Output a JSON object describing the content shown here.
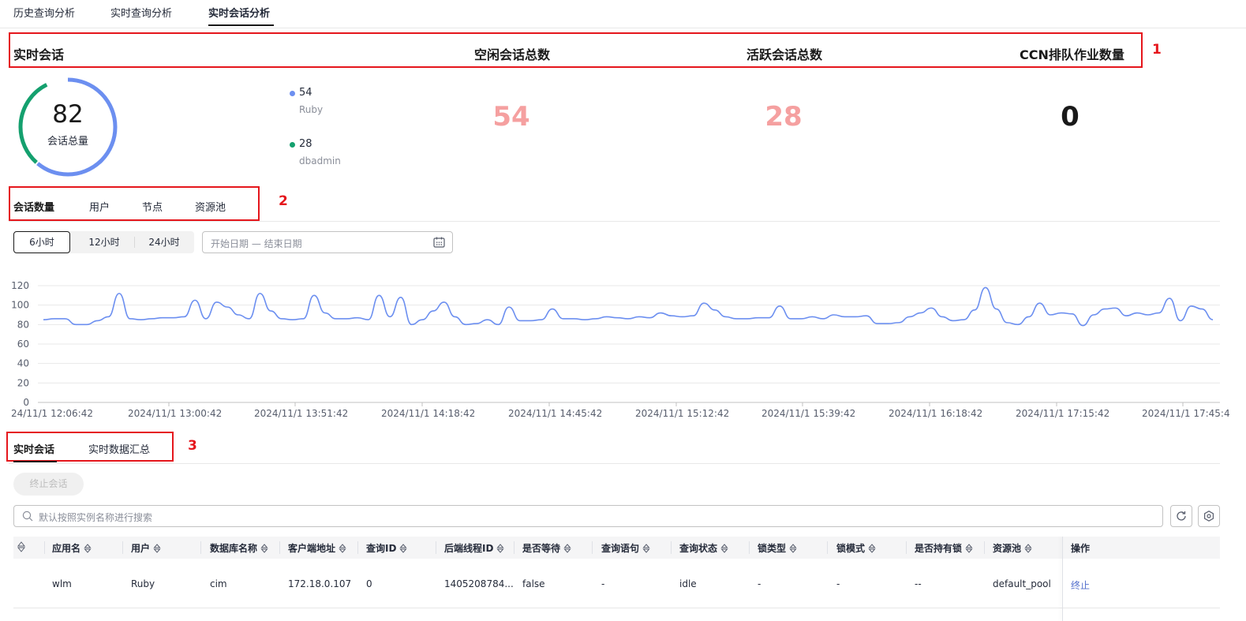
{
  "top_tabs": [
    {
      "label": "历史查询分析"
    },
    {
      "label": "实时查询分析"
    },
    {
      "label": "实时会话分析"
    }
  ],
  "colors": {
    "accent_blue": "#6c8ff0",
    "accent_green": "#14a06e",
    "pink_num": "#f5a0a0",
    "red_annot": "#e5161c",
    "link": "#526ecc"
  },
  "annotations": [
    "1",
    "2",
    "3"
  ],
  "summary": {
    "section_title": "实时会话",
    "idle_title": "空闲会话总数",
    "active_title": "活跃会话总数",
    "ccn_title": "CCN排队作业数量",
    "idle_value": "54",
    "active_value": "28",
    "ccn_value": "0"
  },
  "donut": {
    "total": "82",
    "label": "会话总量",
    "segments": [
      {
        "value": "54",
        "name": "Ruby",
        "color": "#6c8ff0"
      },
      {
        "value": "28",
        "name": "dbadmin",
        "color": "#14a06e"
      }
    ]
  },
  "metric_tabs": [
    {
      "label": "会话数量"
    },
    {
      "label": "用户"
    },
    {
      "label": "节点"
    },
    {
      "label": "资源池"
    }
  ],
  "time_range": {
    "options": [
      "6小时",
      "12小时",
      "24小时"
    ],
    "selected": "6小时",
    "date_placeholder": "开始日期 — 结束日期"
  },
  "chart_data": {
    "type": "line",
    "y_ticks": [
      "120",
      "100",
      "80",
      "60",
      "40",
      "20",
      "0"
    ],
    "ylim": [
      0,
      120
    ],
    "x_tick_labels": [
      "24/11/1 12:06:42",
      "2024/11/1 13:00:42",
      "2024/11/1 13:51:42",
      "2024/11/1 14:18:42",
      "2024/11/1 14:45:42",
      "2024/11/1 15:12:42",
      "2024/11/1 15:39:42",
      "2024/11/1 16:18:42",
      "2024/11/1 17:15:42",
      "2024/11/1 17:45:4"
    ],
    "grid": true,
    "series": [
      {
        "color": "#6c8ff0",
        "values": [
          85,
          86,
          86,
          80,
          80,
          84,
          88,
          112,
          86,
          85,
          86,
          87,
          87,
          88,
          105,
          86,
          103,
          98,
          90,
          86,
          112,
          94,
          86,
          85,
          86,
          110,
          92,
          86,
          86,
          87,
          85,
          110,
          88,
          108,
          80,
          85,
          94,
          103,
          88,
          80,
          81,
          85,
          80,
          98,
          84,
          84,
          85,
          96,
          86,
          86,
          85,
          86,
          88,
          87,
          86,
          88,
          87,
          92,
          89,
          88,
          89,
          102,
          95,
          88,
          86,
          86,
          87,
          87,
          99,
          86,
          86,
          88,
          86,
          90,
          88,
          88,
          89,
          81,
          81,
          82,
          88,
          92,
          97,
          88,
          84,
          85,
          95,
          118,
          96,
          82,
          80,
          88,
          102,
          90,
          92,
          91,
          79,
          90,
          96,
          97,
          89,
          92,
          90,
          92,
          107,
          84,
          99,
          96,
          85
        ]
      }
    ]
  },
  "bottom_tabs": [
    {
      "label": "实时会话"
    },
    {
      "label": "实时数据汇总"
    }
  ],
  "terminate_button": "终止会话",
  "search_placeholder": "默认按照实例名称进行搜索",
  "table": {
    "columns": [
      "应用名",
      "用户",
      "数据库名称",
      "客户端地址",
      "查询ID",
      "后端线程ID",
      "是否等待",
      "查询语句",
      "查询状态",
      "锁类型",
      "锁模式",
      "是否持有锁",
      "资源池",
      "操作"
    ],
    "rows": [
      [
        "wlm",
        "Ruby",
        "cim",
        "172.18.0.107",
        "0",
        "1405208784...",
        "false",
        "-",
        "idle",
        "-",
        "-",
        "--",
        "default_pool",
        "终止"
      ]
    ]
  }
}
